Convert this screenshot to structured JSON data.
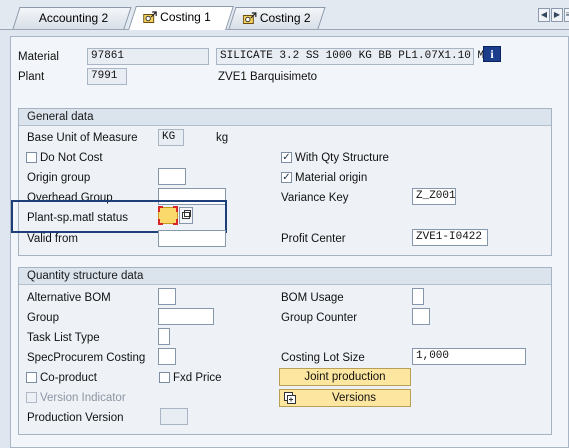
{
  "tabs": [
    {
      "label": "Accounting 2",
      "icon": "none"
    },
    {
      "label": "Costing 1",
      "icon": "costing-icon",
      "active": true
    },
    {
      "label": "Costing 2",
      "icon": "costing-icon"
    }
  ],
  "header": {
    "material_label": "Material",
    "material_value": "97861",
    "material_desc": "SILICATE 3.2 SS 1000 KG BB PL1.07X1.10 M",
    "plant_label": "Plant",
    "plant_value": "7991",
    "plant_desc": "ZVE1 Barquisimeto",
    "info_glyph": "i"
  },
  "general": {
    "title": "General data",
    "base_uom_label": "Base Unit of Measure",
    "base_uom_value": "KG",
    "base_uom_text": "kg",
    "do_not_cost_label": "Do Not Cost",
    "do_not_cost_checked": false,
    "with_qty_label": "With Qty Structure",
    "with_qty_checked": true,
    "origin_group_label": "Origin group",
    "origin_group_value": "",
    "material_origin_label": "Material origin",
    "material_origin_checked": true,
    "overhead_group_label": "Overhead Group",
    "overhead_group_value": "",
    "variance_key_label": "Variance Key",
    "variance_key_value": "Z_Z001",
    "plant_sp_label": "Plant-sp.matl status",
    "plant_sp_value": "",
    "valid_from_label": "Valid from",
    "valid_from_value": "",
    "profit_center_label": "Profit Center",
    "profit_center_value": "ZVE1-I0422"
  },
  "qty": {
    "title": "Quantity structure data",
    "alt_bom_label": "Alternative BOM",
    "alt_bom_value": "",
    "bom_usage_label": "BOM Usage",
    "bom_usage_value": "",
    "group_label": "Group",
    "group_value": "",
    "group_counter_label": "Group Counter",
    "group_counter_value": "",
    "task_list_label": "Task List Type",
    "task_list_value": "",
    "spec_proc_label": "SpecProcurem Costing",
    "spec_proc_value": "",
    "costing_lot_label": "Costing Lot Size",
    "costing_lot_value": "1,000",
    "coproduct_label": "Co-product",
    "coproduct_checked": false,
    "fxd_price_label": "Fxd Price",
    "fxd_price_checked": false,
    "joint_prod_label": "Joint production",
    "version_ind_label": "Version Indicator",
    "version_ind_checked": false,
    "versions_label": "Versions",
    "prod_version_label": "Production Version",
    "prod_version_value": ""
  },
  "colors": {
    "highlight_border": "#1f3f7a",
    "focus_field": "#fbd96a",
    "focus_marker": "#d9262b",
    "button_bg": "#fde7a0"
  }
}
